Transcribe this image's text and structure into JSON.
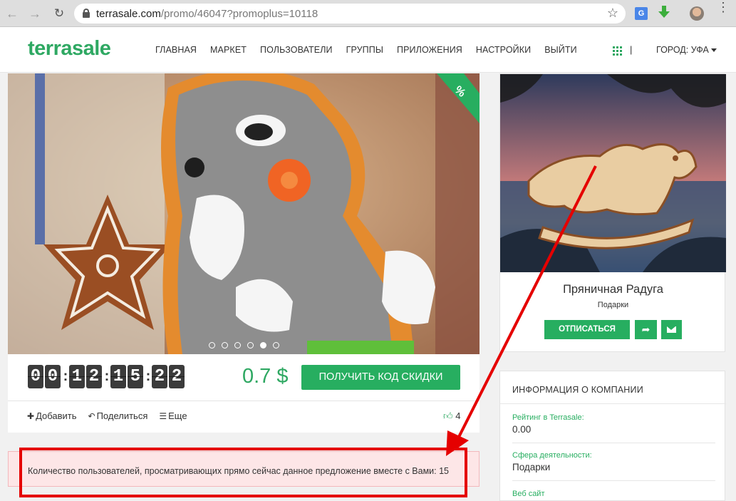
{
  "browser": {
    "url_domain": "terrasale.com",
    "url_path": "/promo/46047?promoplus=10118",
    "translate_badge": "G"
  },
  "header": {
    "logo": "terrasale",
    "nav": [
      "ГЛАВНАЯ",
      "МАРКЕТ",
      "ПОЛЬЗОВАТЕЛИ",
      "ГРУППЫ",
      "ПРИЛОЖЕНИЯ",
      "НАСТРОЙКИ",
      "ВЫЙТИ"
    ],
    "separator": "|",
    "city": "ГОРОД: УФА"
  },
  "promo": {
    "ribbon_text": "%",
    "timer": [
      "0",
      "0",
      ":",
      "1",
      "2",
      ":",
      "1",
      "5",
      ":",
      "2",
      "2"
    ],
    "price": "0.7 $",
    "cta": "ПОЛУЧИТЬ КОД СКИДКИ",
    "actions": {
      "add": "Добавить",
      "share": "Поделиться",
      "more": "Еще"
    },
    "likes": "4",
    "carousel": {
      "count": 6,
      "active_index": 4
    }
  },
  "alert": {
    "text": "Количество пользователей, просматривающих прямо сейчас данное предложение вместе с Вами: 15"
  },
  "company": {
    "name": "Пряничная Радуга",
    "category": "Подарки",
    "unsubscribe": "ОТПИСАТЬСЯ"
  },
  "company_info": {
    "title": "ИНФОРМАЦИЯ О КОМПАНИИ",
    "rating_label": "Рейтинг в Terrasale:",
    "rating_value": "0.00",
    "sphere_label": "Сфера деятельности:",
    "sphere_value": "Подарки",
    "website_label": "Веб сайт"
  },
  "colors": {
    "brand": "#2ea862",
    "button": "#27ae60",
    "highlight": "#e50000",
    "alert_bg": "#fde6e7"
  }
}
